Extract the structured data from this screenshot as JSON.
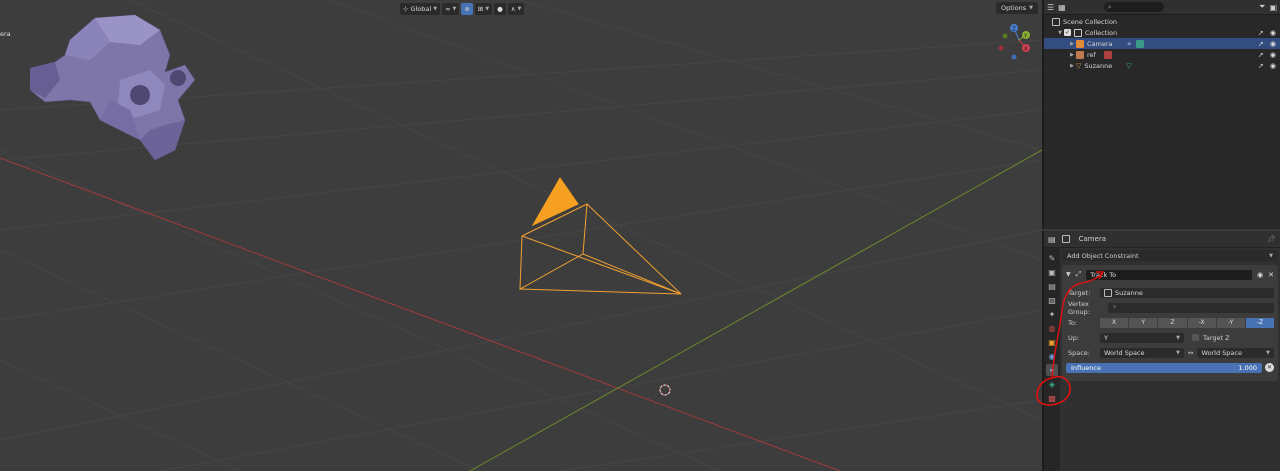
{
  "viewport": {
    "transform_orientation": "Global",
    "options_label": "Options",
    "cut_label": "era",
    "colors": {
      "background": "#3d3d3d",
      "grid": "#454545",
      "x_axis": "#a13a3a",
      "y_axis": "#6b8a2a",
      "camera": "#f0a030",
      "suzanne": "#8e86b8"
    },
    "gizmo": {
      "labels": [
        "Z",
        "Y",
        "X"
      ]
    }
  },
  "outliner": {
    "search_placeholder": "",
    "items": [
      {
        "label": "Scene Collection",
        "icon": "scene-collection-icon",
        "selected": false
      },
      {
        "label": "Collection",
        "icon": "collection-icon",
        "selected": false
      },
      {
        "label": "Camera",
        "icon": "camera-object-icon",
        "selected": true
      },
      {
        "label": "ref",
        "icon": "empty-image-icon",
        "selected": false
      },
      {
        "label": "Suzanne",
        "icon": "mesh-icon",
        "selected": false
      }
    ]
  },
  "properties": {
    "object_name": "Camera",
    "add_constraint_label": "Add Object Constraint",
    "constraint": {
      "name": "Track To",
      "target_label": "Target:",
      "target_value": "Suzanne",
      "vertex_group_label": "Vertex Group:",
      "to_label": "To:",
      "to_axes": [
        "X",
        "Y",
        "Z",
        "-X",
        "-Y",
        "-Z"
      ],
      "to_active": "-Z",
      "up_label": "Up:",
      "up_value": "Y",
      "target_z_label": "Target Z",
      "space_label": "Space:",
      "owner_space": "World Space",
      "target_space": "World Space",
      "influence_label": "Influence",
      "influence_value": "1.000"
    }
  }
}
